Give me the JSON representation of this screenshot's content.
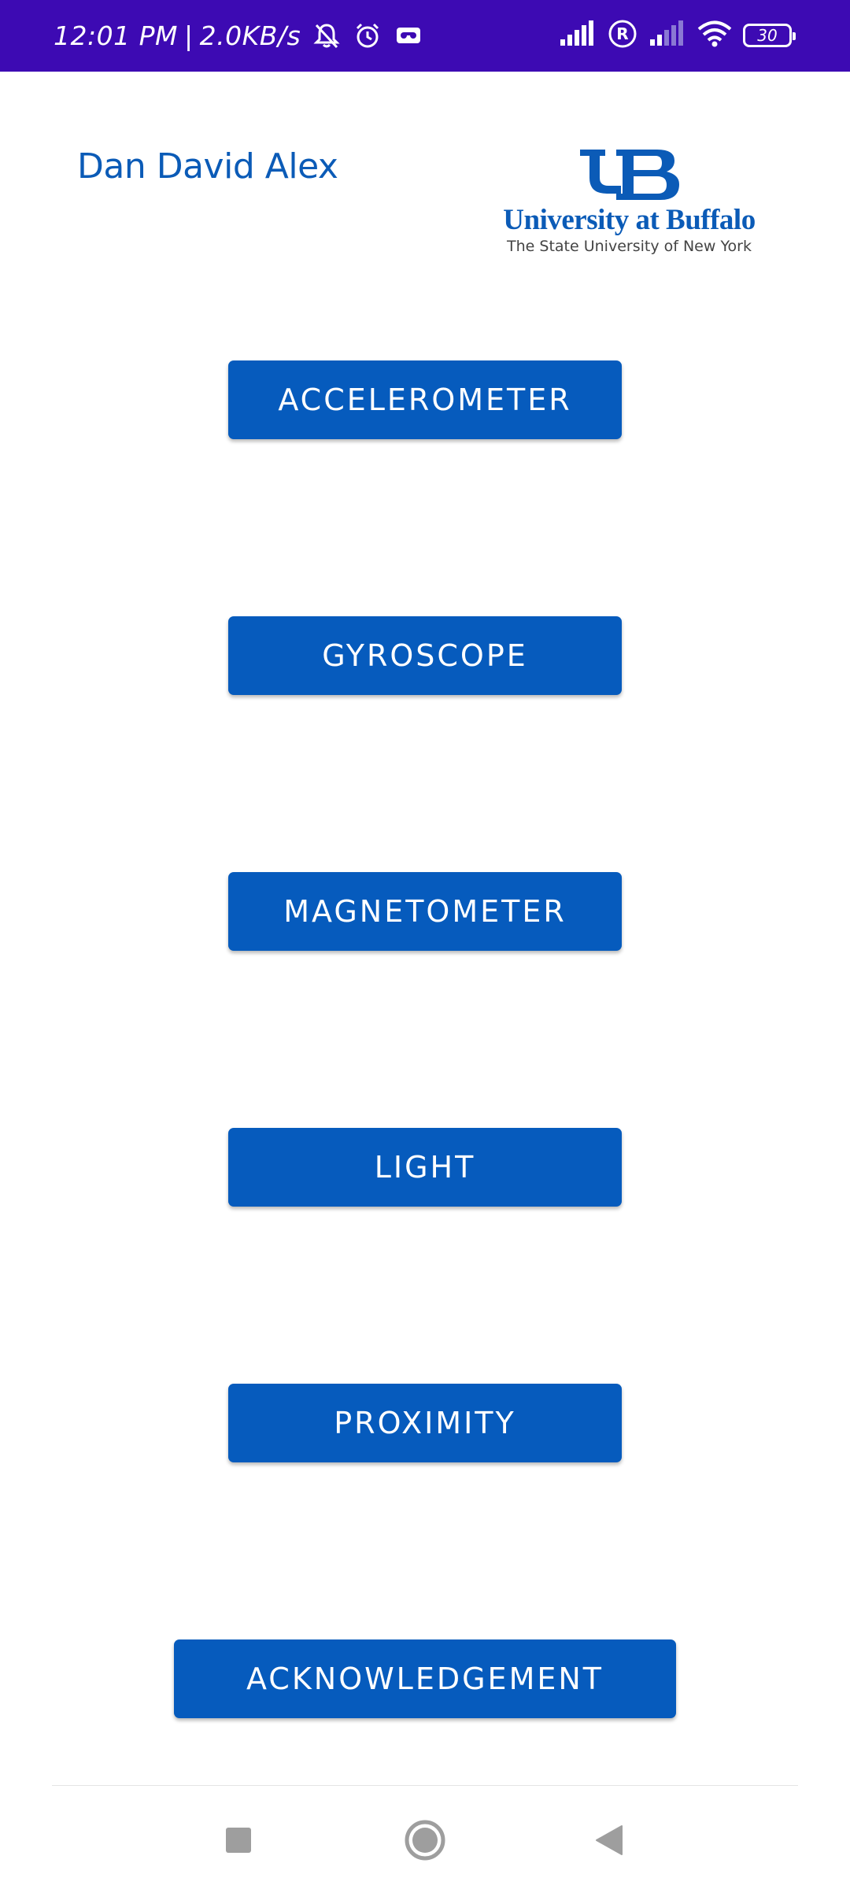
{
  "status_bar": {
    "time": "12:01 PM",
    "separator": "|",
    "network_speed": "2.0KB/s",
    "battery_level": "30",
    "icons": [
      "mute-bell-icon",
      "alarm-icon",
      "voicemail-icon",
      "signal-icon",
      "roaming-icon",
      "signal-weak-icon",
      "wifi-icon",
      "battery-icon"
    ],
    "background_color": "#3d0ab3"
  },
  "header": {
    "student_name": "Dan David Alex",
    "logo": {
      "wordmark": "University at Buffalo",
      "tagline": "The State University of New York"
    }
  },
  "buttons": {
    "accelerometer": "ACCELEROMETER",
    "gyroscope": "GYROSCOPE",
    "magnetometer": "MAGNETOMETER",
    "light": "LIGHT",
    "proximity": "PROXIMITY",
    "acknowledgement": "ACKNOWLEDGEMENT"
  },
  "nav_bar": {
    "icons": [
      "recents-square-icon",
      "home-circle-icon",
      "back-triangle-icon"
    ]
  },
  "colors": {
    "accent": "#065bbd",
    "name_text": "#0b5bb7",
    "background": "#ffffff"
  }
}
